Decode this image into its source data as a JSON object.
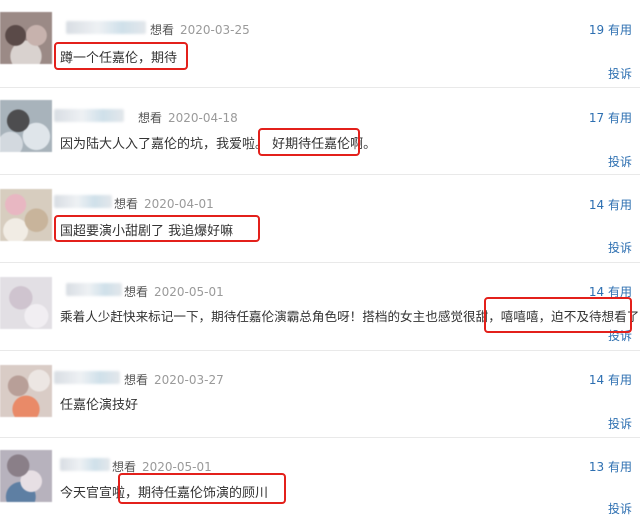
{
  "comments": [
    {
      "status": "想看",
      "date": "2020-03-25",
      "text": "蹲一个任嘉伦，期待",
      "useful_count": "19",
      "useful_label": "有用",
      "report": "投诉"
    },
    {
      "status": "想看",
      "date": "2020-04-18",
      "text": "因为陆大人入了嘉伦的坑，我爱啦。 好期待任嘉伦啊。",
      "useful_count": "17",
      "useful_label": "有用",
      "report": "投诉"
    },
    {
      "status": "想看",
      "date": "2020-04-01",
      "text": "国超要演小甜剧了 我追爆好嘛",
      "useful_count": "14",
      "useful_label": "有用",
      "report": "投诉"
    },
    {
      "status": "想看",
      "date": "2020-05-01",
      "text": "乘着人少赶快来标记一下，期待任嘉伦演霸总角色呀！搭档的女主也感觉很甜，嘻嘻嘻，迫不及待想看了！",
      "useful_count": "14",
      "useful_label": "有用",
      "report": "投诉"
    },
    {
      "status": "想看",
      "date": "2020-03-27",
      "text": "任嘉伦演技好",
      "useful_count": "14",
      "useful_label": "有用",
      "report": "投诉"
    },
    {
      "status": "想看",
      "date": "2020-05-01",
      "text": "今天官宣啦，期待任嘉伦饰演的顾川",
      "useful_count": "13",
      "useful_label": "有用",
      "report": "投诉"
    }
  ],
  "colors": {
    "link": "#2d6fb1",
    "highlight": "#e3201b",
    "text": "#333333"
  }
}
